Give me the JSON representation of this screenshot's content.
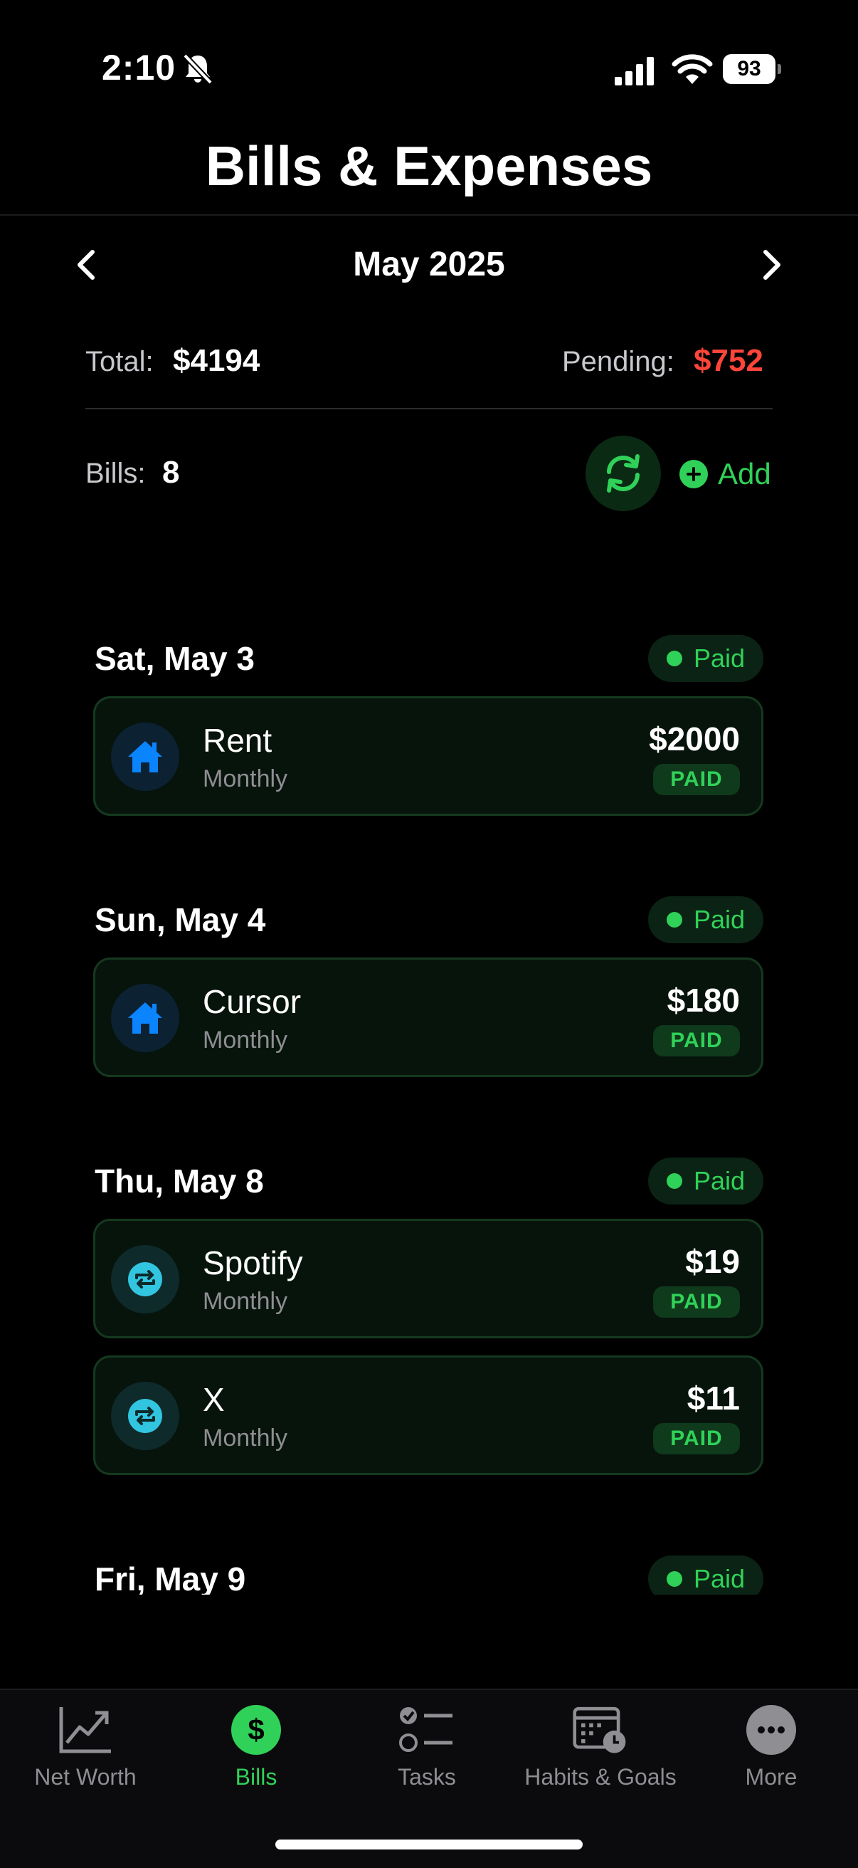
{
  "status_bar": {
    "time": "2:10",
    "battery": "93"
  },
  "page_title": "Bills & Expenses",
  "month": {
    "label": "May 2025"
  },
  "summary": {
    "total_label": "Total:",
    "total_value": "$4194",
    "pending_label": "Pending:",
    "pending_value": "$752",
    "bills_label": "Bills:",
    "bills_value": "8",
    "add_label": "Add"
  },
  "groups": [
    {
      "date": "Sat, May 3",
      "status": "Paid",
      "bills": [
        {
          "name": "Rent",
          "frequency": "Monthly",
          "amount": "$2000",
          "badge": "PAID",
          "icon": "house-icon"
        }
      ]
    },
    {
      "date": "Sun, May 4",
      "status": "Paid",
      "bills": [
        {
          "name": "Cursor",
          "frequency": "Monthly",
          "amount": "$180",
          "badge": "PAID",
          "icon": "house-icon"
        }
      ]
    },
    {
      "date": "Thu, May 8",
      "status": "Paid",
      "bills": [
        {
          "name": "Spotify",
          "frequency": "Monthly",
          "amount": "$19",
          "badge": "PAID",
          "icon": "repeat-icon"
        },
        {
          "name": "X",
          "frequency": "Monthly",
          "amount": "$11",
          "badge": "PAID",
          "icon": "repeat-icon"
        }
      ]
    },
    {
      "date": "Fri, May 9",
      "status": "Paid",
      "bills": []
    }
  ],
  "tabs": [
    {
      "label": "Net Worth",
      "icon": "chart-trend-icon"
    },
    {
      "label": "Bills",
      "icon": "dollar-icon",
      "active": true
    },
    {
      "label": "Tasks",
      "icon": "checklist-icon"
    },
    {
      "label": "Habits & Goals",
      "icon": "calendar-clock-icon"
    },
    {
      "label": "More",
      "icon": "ellipsis-icon"
    }
  ],
  "colors": {
    "accent": "#30d158",
    "pending": "#ff453a",
    "home_icon": "#0a84ff",
    "sub_icon": "#32c5e0"
  }
}
